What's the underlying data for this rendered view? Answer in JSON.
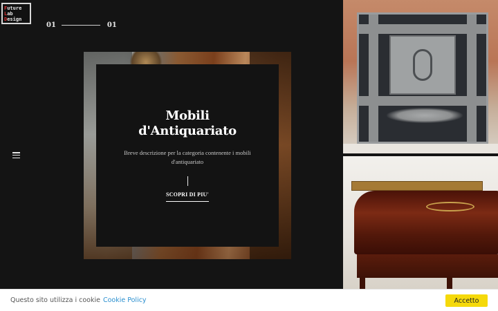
{
  "logo": {
    "lines": [
      {
        "cap": "F",
        "rest": "uture"
      },
      {
        "cap": "L",
        "rest": "ab"
      },
      {
        "cap": "D",
        "rest": "esign"
      }
    ]
  },
  "slider": {
    "current": "01",
    "total": "01"
  },
  "hero": {
    "title_line1": "Mobili",
    "title_line2": "d'Antiquariato",
    "description": "Breve descrizione per la categoria contenente i mobili d'antiquariato",
    "cta_label": "SCOPRI DI PIU'"
  },
  "cookie": {
    "text": "Questo sito utilizza i cookie",
    "link_label": "Cookie Policy",
    "accept_label": "Accetto"
  },
  "colors": {
    "background": "#141414",
    "accent_yellow": "#f5d90a",
    "link_blue": "#2a8fcf",
    "logo_red": "#e03030"
  },
  "icons": {
    "menu": "hamburger-menu-icon"
  }
}
